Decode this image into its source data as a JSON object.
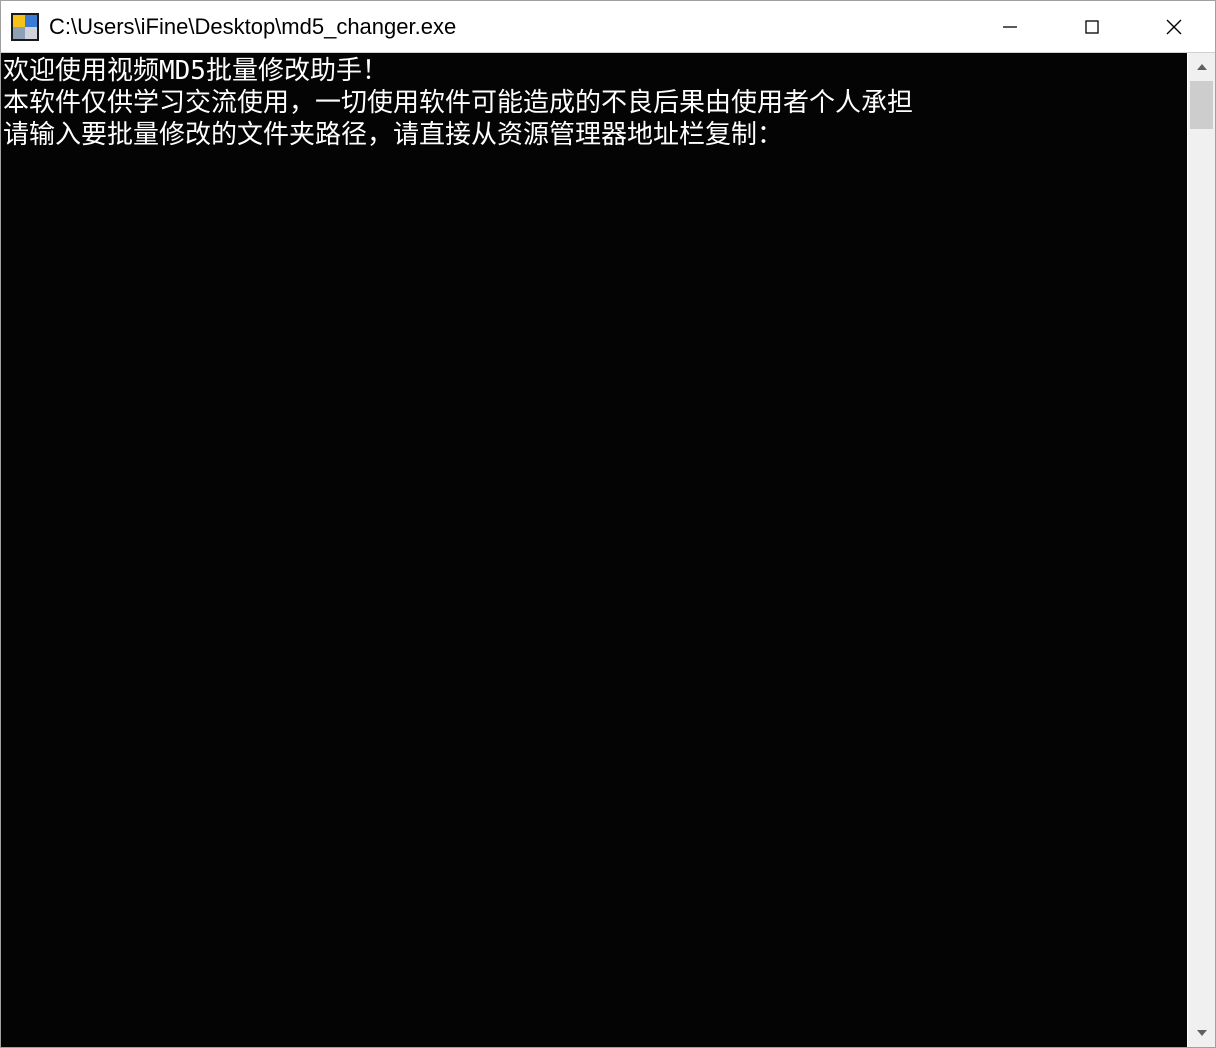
{
  "title": "C:\\Users\\iFine\\Desktop\\md5_changer.exe",
  "console": {
    "line1": "欢迎使用视频MD5批量修改助手！",
    "line2": "本软件仅供学习交流使用，一切使用软件可能造成的不良后果由使用者个人承担",
    "line3": "请输入要批量修改的文件夹路径，请直接从资源管理器地址栏复制："
  }
}
